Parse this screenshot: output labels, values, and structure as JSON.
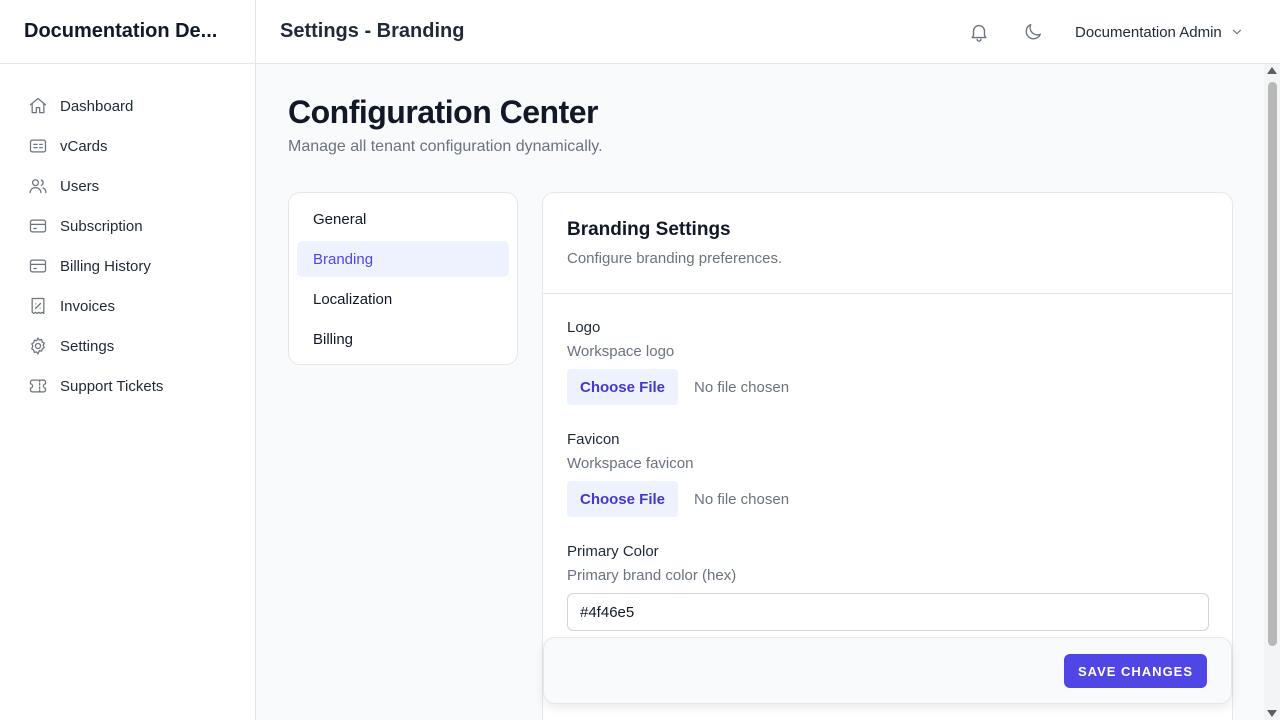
{
  "app": {
    "brand": "Documentation De..."
  },
  "header": {
    "title": "Settings - Branding",
    "notifications_icon": "bell-icon",
    "theme_icon": "moon-icon",
    "user_name": "Documentation Admin"
  },
  "sidebar": {
    "items": [
      {
        "label": "Dashboard",
        "icon": "home-icon"
      },
      {
        "label": "vCards",
        "icon": "id-card-icon"
      },
      {
        "label": "Users",
        "icon": "users-icon"
      },
      {
        "label": "Subscription",
        "icon": "credit-card-icon"
      },
      {
        "label": "Billing History",
        "icon": "credit-card-icon"
      },
      {
        "label": "Invoices",
        "icon": "receipt-icon"
      },
      {
        "label": "Settings",
        "icon": "gear-icon"
      },
      {
        "label": "Support Tickets",
        "icon": "ticket-icon"
      }
    ]
  },
  "main": {
    "title": "Configuration Center",
    "subtitle": "Manage all tenant configuration dynamically."
  },
  "tabs": [
    {
      "label": "General",
      "active": false
    },
    {
      "label": "Branding",
      "active": true
    },
    {
      "label": "Localization",
      "active": false
    },
    {
      "label": "Billing",
      "active": false
    }
  ],
  "panel": {
    "title": "Branding Settings",
    "description": "Configure branding preferences.",
    "logo": {
      "label": "Logo",
      "help": "Workspace logo",
      "button": "Choose File",
      "status": "No file chosen"
    },
    "favicon": {
      "label": "Favicon",
      "help": "Workspace favicon",
      "button": "Choose File",
      "status": "No file chosen"
    },
    "primary_color": {
      "label": "Primary Color",
      "help": "Primary brand color (hex)",
      "value": "#4f46e5"
    }
  },
  "actions": {
    "save_label": "SAVE CHANGES"
  },
  "colors": {
    "accent": "#4f46e5",
    "accent_light": "#eef2ff"
  }
}
